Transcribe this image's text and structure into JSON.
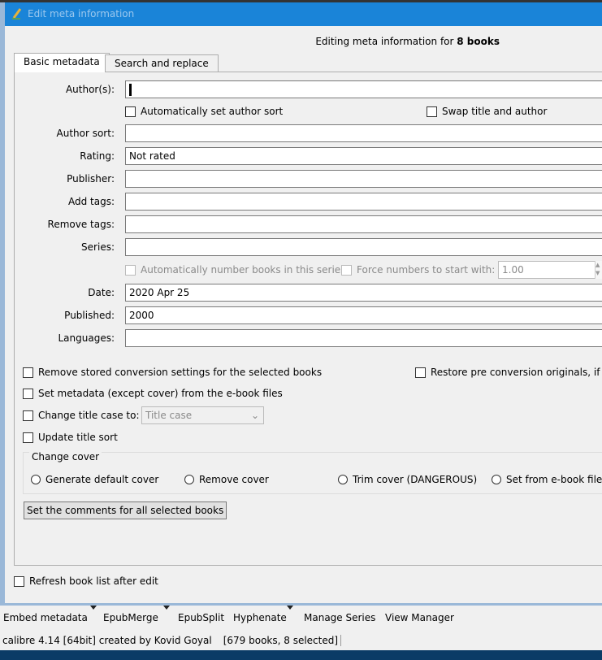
{
  "dialog": {
    "title": "Edit meta information",
    "heading_prefix": "Editing meta information for ",
    "heading_count": "8 books"
  },
  "tabs": [
    {
      "label": "Basic metadata"
    },
    {
      "label": "Search and replace"
    }
  ],
  "fields": {
    "authors": {
      "label": "Author(s):",
      "value": ""
    },
    "auto_author_sort": "Automatically set author sort",
    "swap_title_author": "Swap title and author",
    "author_sort": {
      "label": "Author sort:",
      "value": ""
    },
    "rating": {
      "label": "Rating:",
      "value": "Not rated"
    },
    "publisher": {
      "label": "Publisher:",
      "value": ""
    },
    "add_tags": {
      "label": "Add tags:",
      "value": ""
    },
    "remove_tags": {
      "label": "Remove tags:",
      "value": ""
    },
    "series": {
      "label": "Series:",
      "value": ""
    },
    "auto_number": "Automatically number books in this series",
    "force_numbers": "Force numbers to start with:",
    "force_value": "1.00",
    "date": {
      "label": "Date:",
      "value": "2020 Apr 25"
    },
    "published": {
      "label": "Published:",
      "value": "2000"
    },
    "languages": {
      "label": "Languages:",
      "value": ""
    }
  },
  "options": {
    "remove_conversion": "Remove stored conversion settings for the selected books",
    "restore_originals": "Restore pre conversion originals, if av",
    "set_metadata": "Set metadata (except cover) from the e-book files",
    "change_title_case": "Change title case to:",
    "title_case_value": "Title case",
    "update_title_sort": "Update title sort"
  },
  "cover": {
    "group_label": "Change cover",
    "options": [
      "Generate default cover",
      "Remove cover",
      "Trim cover (DANGEROUS)",
      "Set from e-book files"
    ]
  },
  "comments_button": "Set the comments for all selected books",
  "refresh": "Refresh book list after edit",
  "toolbar": [
    "Embed metadata",
    "EpubMerge",
    "EpubSplit",
    "Hyphenate",
    "Manage Series",
    "View Manager"
  ],
  "status": {
    "app": "calibre 4.14 [64bit] created by Kovid Goyal",
    "books": "[679 books, 8 selected]"
  }
}
